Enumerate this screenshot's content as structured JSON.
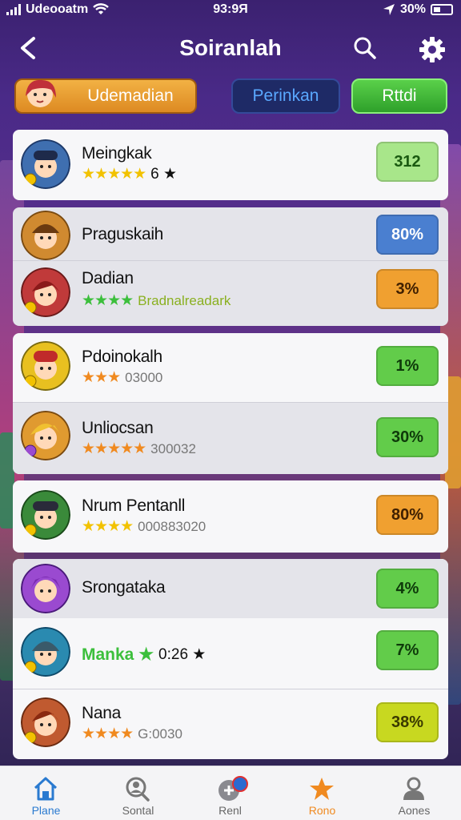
{
  "status_bar": {
    "carrier": "Udeooatm",
    "time": "93:9Я",
    "battery": "30%"
  },
  "header": {
    "title": "Soiranlah"
  },
  "tabs": [
    {
      "label": "Udemadian"
    },
    {
      "label": "Perinkan"
    },
    {
      "label": "Rttdi"
    }
  ],
  "players": [
    {
      "name": "Meingkak",
      "stars": "★★★★★",
      "star_color": "#f2c200",
      "extra": "6 ★",
      "extra_color": "#111",
      "badge": "312",
      "badge_bg": "#a8e68a",
      "badge_fg": "#1a5a10",
      "avatar_color": "#3f6fb0"
    },
    {
      "name": "Praguskaih",
      "stars": "",
      "star_color": "#f2c200",
      "extra": "",
      "extra_color": "#777",
      "badge": "80%",
      "badge_bg": "#4a7fd0",
      "badge_fg": "#ffffff",
      "avatar_color": "#d08a30"
    },
    {
      "name": "Dadian",
      "stars": "★★★★",
      "star_color": "#3cbf3c",
      "extra": "Bradnalreadark",
      "extra_color": "#8ab020",
      "badge": "3%",
      "badge_bg": "#f0a030",
      "badge_fg": "#402000",
      "avatar_color": "#c03a3a"
    },
    {
      "name": "Pdoinokalh",
      "stars": "★★★",
      "star_color": "#f08a20",
      "extra": "03000",
      "extra_color": "#777",
      "badge": "1%",
      "badge_bg": "#62cc4a",
      "badge_fg": "#0e3a0a",
      "avatar_color": "#e8c020"
    },
    {
      "name": "Unliocsan",
      "stars": "★★★★★",
      "star_color": "#f08a20",
      "extra": "300032",
      "extra_color": "#777",
      "badge": "30%",
      "badge_bg": "#62cc4a",
      "badge_fg": "#0e3a0a",
      "avatar_color": "#e09a30"
    },
    {
      "name": "Nrum Pentanll",
      "stars": "★★★★",
      "star_color": "#f2c200",
      "extra": "000883020",
      "extra_color": "#777",
      "badge": "80%",
      "badge_bg": "#f0a030",
      "badge_fg": "#402000",
      "avatar_color": "#3a8a3a"
    },
    {
      "name": "Srongataka",
      "stars": "",
      "star_color": "#f2c200",
      "extra": "",
      "extra_color": "#777",
      "badge": "4%",
      "badge_bg": "#62cc4a",
      "badge_fg": "#0e3a0a",
      "avatar_color": "#9a4ad0"
    },
    {
      "name": "Manka ★",
      "stars": "",
      "star_color": "#3cbf3c",
      "extra": "0:26 ★",
      "extra_color": "#111",
      "badge": "7%",
      "badge_bg": "#62cc4a",
      "badge_fg": "#0e3a0a",
      "avatar_color": "#2a8ab0"
    },
    {
      "name": "Nana",
      "stars": "★★★★",
      "star_color": "#f08a20",
      "extra": "G:0030",
      "extra_color": "#777",
      "badge": "38%",
      "badge_bg": "#c8d820",
      "badge_fg": "#3a3a00",
      "avatar_color": "#c05a30"
    }
  ],
  "bottom_nav": [
    {
      "label": "Plane",
      "icon": "home-icon",
      "color": "#2a7ad0"
    },
    {
      "label": "Sontal",
      "icon": "search-person-icon",
      "color": "#666666"
    },
    {
      "label": "Renl",
      "icon": "chat-icon",
      "color": "#666666"
    },
    {
      "label": "Rono",
      "icon": "star-icon",
      "color": "#f08a20"
    },
    {
      "label": "Aones",
      "icon": "profile-icon",
      "color": "#666666"
    }
  ],
  "colors": {
    "accent": "#4a2a88",
    "star_active": "#f08a20"
  }
}
